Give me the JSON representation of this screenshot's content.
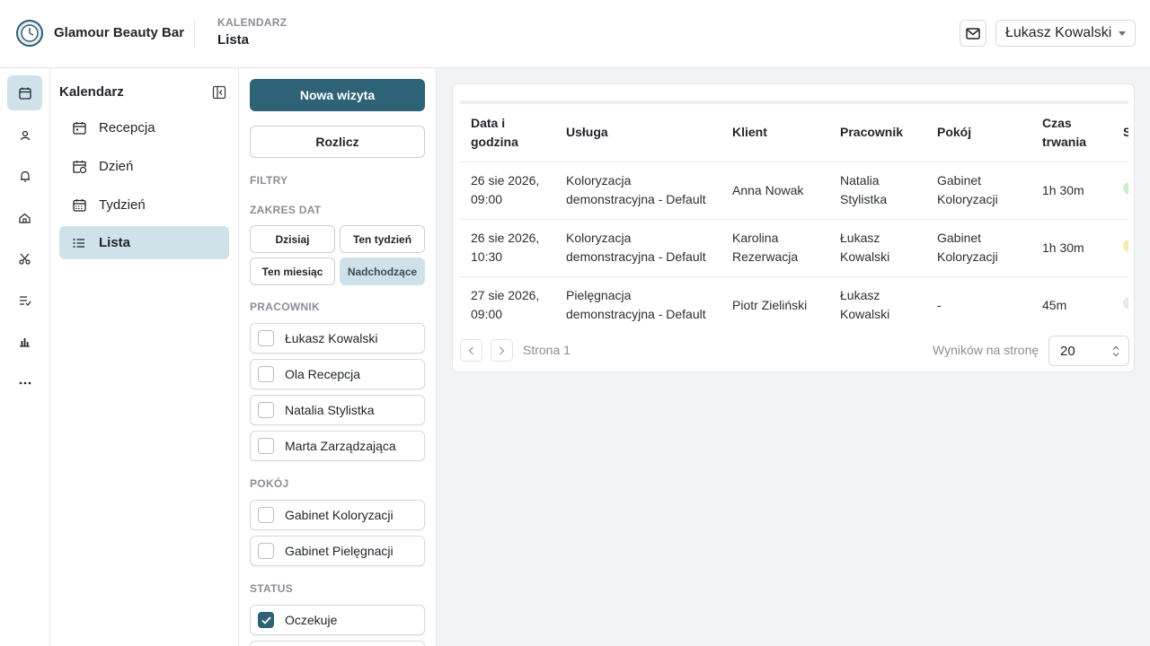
{
  "header": {
    "app_name": "Glamour Beauty Bar",
    "breadcrumb_section": "KALENDARZ",
    "breadcrumb_page": "Lista",
    "user_name": "Łukasz Kowalski"
  },
  "rail": {
    "items": [
      {
        "icon": "calendar-icon",
        "active": true
      },
      {
        "icon": "clients-icon",
        "active": false
      },
      {
        "icon": "bell-icon",
        "active": false
      },
      {
        "icon": "home-icon",
        "active": false
      },
      {
        "icon": "scissors-icon",
        "active": false
      },
      {
        "icon": "checklist-icon",
        "active": false
      },
      {
        "icon": "chart-icon",
        "active": false
      },
      {
        "icon": "more-icon",
        "active": false
      }
    ]
  },
  "nav": {
    "title": "Kalendarz",
    "items": [
      {
        "label": "Recepcja",
        "icon": "calendar-icon",
        "active": false
      },
      {
        "label": "Dzień",
        "icon": "calendar-clock-icon",
        "active": false
      },
      {
        "label": "Tydzień",
        "icon": "calendar-week-icon",
        "active": false
      },
      {
        "label": "Lista",
        "icon": "list-icon",
        "active": true
      }
    ]
  },
  "filters": {
    "new_visit_label": "Nowa wizyta",
    "settle_label": "Rozlicz",
    "filters_heading": "FILTRY",
    "date_range_heading": "ZAKRES DAT",
    "date_chips": [
      {
        "label": "Dzisiaj",
        "active": false
      },
      {
        "label": "Ten tydzień",
        "active": false
      },
      {
        "label": "Ten miesiąc",
        "active": false
      },
      {
        "label": "Nadchodzące",
        "active": true
      }
    ],
    "employee_heading": "PRACOWNIK",
    "employees": [
      {
        "label": "Łukasz Kowalski",
        "checked": false
      },
      {
        "label": "Ola Recepcja",
        "checked": false
      },
      {
        "label": "Natalia Stylistka",
        "checked": false
      },
      {
        "label": "Marta Zarządzająca",
        "checked": false
      }
    ],
    "room_heading": "POKÓJ",
    "rooms": [
      {
        "label": "Gabinet Koloryzacji",
        "checked": false
      },
      {
        "label": "Gabinet Pielęgnacji",
        "checked": false
      }
    ],
    "status_heading": "STATUS",
    "statuses": [
      {
        "label": "Oczekuje",
        "checked": true
      }
    ]
  },
  "table": {
    "columns": [
      "Data i godzina",
      "Usługa",
      "Klient",
      "Pracownik",
      "Pokój",
      "Czas trwania",
      "Status"
    ],
    "rows": [
      {
        "datetime": "26 sie 2026, 09:00",
        "service": "Koloryzacja demonstracyjna - Default",
        "client": "Anna Nowak",
        "employee": "Natalia Stylistka",
        "room": "Gabinet Koloryzacji",
        "duration": "1h 30m",
        "status_color": "#cdeccf"
      },
      {
        "datetime": "26 sie 2026, 10:30",
        "service": "Koloryzacja demonstracyjna - Default",
        "client": "Karolina Rezerwacja",
        "employee": "Łukasz Kowalski",
        "room": "Gabinet Koloryzacji",
        "duration": "1h 30m",
        "status_color": "#f7e7b0"
      },
      {
        "datetime": "27 sie 2026, 09:00",
        "service": "Pielęgnacja demonstracyjna - Default",
        "client": "Piotr Zieliński",
        "employee": "Łukasz Kowalski",
        "room": "-",
        "duration": "45m",
        "status_color": "#e6e8eb"
      }
    ]
  },
  "pagination": {
    "page_label": "Strona 1",
    "per_page_label": "Wyników na stronę",
    "per_page_value": "20"
  },
  "colors": {
    "primary": "#2e6377",
    "active_bg": "#cfe2ea"
  }
}
